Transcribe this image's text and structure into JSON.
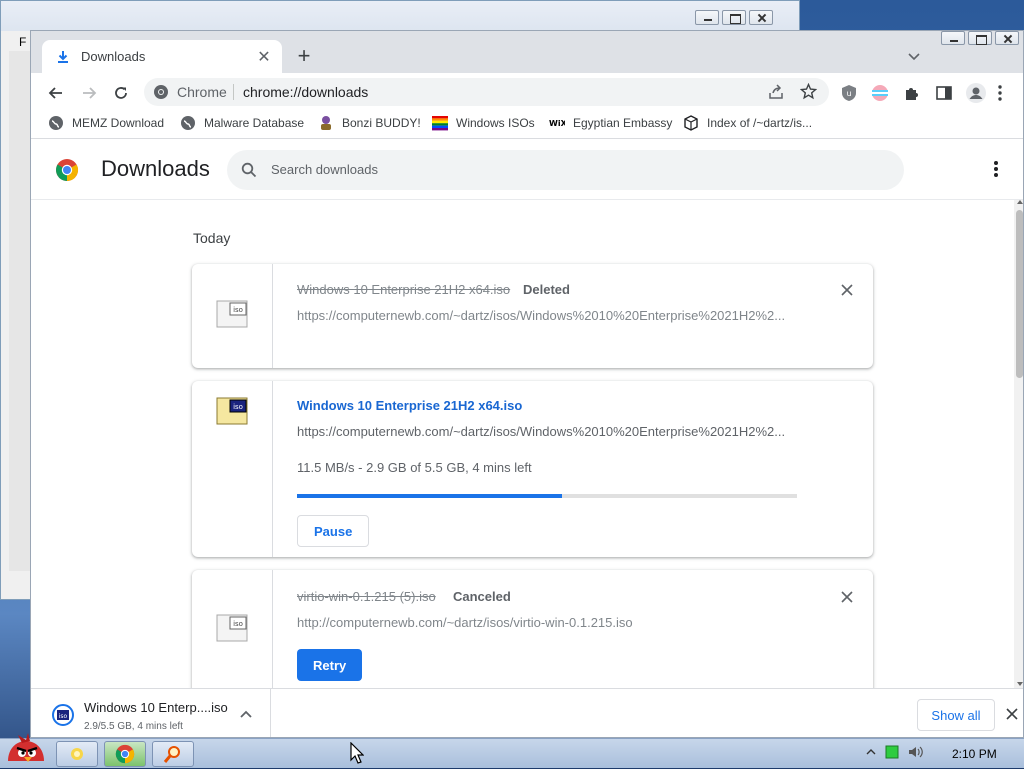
{
  "background_window": {
    "menu_letter": "F"
  },
  "tab": {
    "title": "Downloads",
    "close": "✕",
    "new_tab": "+"
  },
  "omnibox": {
    "site": "Chrome",
    "url": "chrome://downloads"
  },
  "bookmarks": [
    {
      "label": "MEMZ Download"
    },
    {
      "label": "Malware Database"
    },
    {
      "label": "Bonzi BUDDY!"
    },
    {
      "label": "Windows ISOs"
    },
    {
      "label": "Egyptian Embassy"
    },
    {
      "label": "Index of /~dartz/is..."
    }
  ],
  "page": {
    "title": "Downloads",
    "search_placeholder": "Search downloads",
    "section": "Today"
  },
  "downloads": [
    {
      "filename": "Windows 10 Enterprise 21H2 x64.iso",
      "status": "Deleted",
      "url": "https://computernewb.com/~dartz/isos/Windows%2010%20Enterprise%2021H2%2..."
    },
    {
      "filename": "Windows 10 Enterprise 21H2 x64.iso",
      "url": "https://computernewb.com/~dartz/isos/Windows%2010%20Enterprise%2021H2%2...",
      "progress_text": "11.5 MB/s - 2.9 GB of 5.5 GB, 4 mins left",
      "progress": 0.53,
      "button": "Pause"
    },
    {
      "filename": "virtio-win-0.1.215 (5).iso",
      "status": "Canceled",
      "url": "http://computernewb.com/~dartz/isos/virtio-win-0.1.215.iso",
      "button": "Retry"
    }
  ],
  "shelf": {
    "name": "Windows 10 Enterp....iso",
    "status": "2.9/5.5 GB, 4 mins left",
    "show_all": "Show all"
  },
  "taskbar": {
    "clock": "2:10 PM"
  },
  "colors": {
    "accent": "#1a73e8",
    "link": "#1967d2"
  }
}
